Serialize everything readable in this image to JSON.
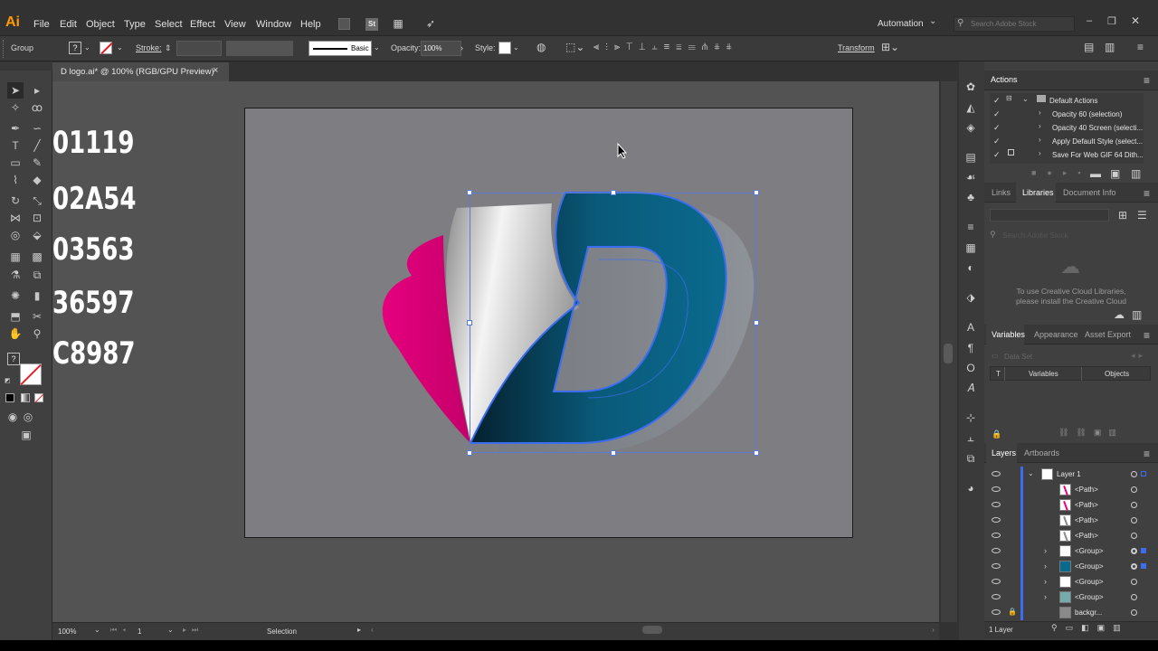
{
  "app": {
    "logo": "Ai"
  },
  "menu": [
    "File",
    "Edit",
    "Object",
    "Type",
    "Select",
    "Effect",
    "View",
    "Window",
    "Help"
  ],
  "menu_icons": {
    "st": "St"
  },
  "workspace": {
    "label": "Automation",
    "chevron": "⌄"
  },
  "search": {
    "placeholder": "Search Adobe Stock"
  },
  "options": {
    "selection_label": "Group",
    "stroke_label": "Stroke:",
    "stroke_value": "",
    "brush_label": "Basic",
    "opacity_label": "Opacity:",
    "opacity_value": "100%",
    "style_label": "Style:",
    "transform_label": "Transform"
  },
  "document": {
    "tab_title": "D logo.ai* @ 100% (RGB/GPU Preview)",
    "close": "×"
  },
  "artwork_text": [
    "01119",
    "02A54",
    "03563",
    "36597",
    "C8987"
  ],
  "status": {
    "zoom": "100%",
    "artboard": "1",
    "tool": "Selection"
  },
  "actions_panel": {
    "title": "Actions",
    "items": [
      {
        "label": "Default Actions",
        "type": "set"
      },
      {
        "label": "Opacity 60 (selection)",
        "type": "action"
      },
      {
        "label": "Opacity 40 Screen (selecti...",
        "type": "action"
      },
      {
        "label": "Apply Default Style (select...",
        "type": "action"
      },
      {
        "label": "Save For Web GIF 64 Dith...",
        "type": "action"
      }
    ]
  },
  "libraries_panel": {
    "tabs": [
      "Links",
      "Libraries",
      "Document Info"
    ],
    "active_tab": "Libraries",
    "search_placeholder": "Search Adobe Stock",
    "message_line1": "To use Creative Cloud Libraries,",
    "message_line2": "please install the Creative Cloud"
  },
  "variables_panel": {
    "tabs": [
      "Variables",
      "Appearance",
      "Asset Export"
    ],
    "data_set": "Data Set",
    "col_t": "T",
    "col_variables": "Variables",
    "col_objects": "Objects"
  },
  "layers_panel": {
    "tabs": [
      "Layers",
      "Artboards"
    ],
    "layer_name": "Layer 1",
    "rows": [
      "<Path>",
      "<Path>",
      "<Path>",
      "<Path>",
      "<Group>",
      "<Group>",
      "<Group>",
      "<Group>",
      "backgr..."
    ],
    "footer": "1 Layer"
  },
  "colors": {
    "accent_logo": "#ff9a00",
    "magenta": "#e6007e",
    "teal": "#0a6a8e",
    "selection": "#3c6df0"
  }
}
